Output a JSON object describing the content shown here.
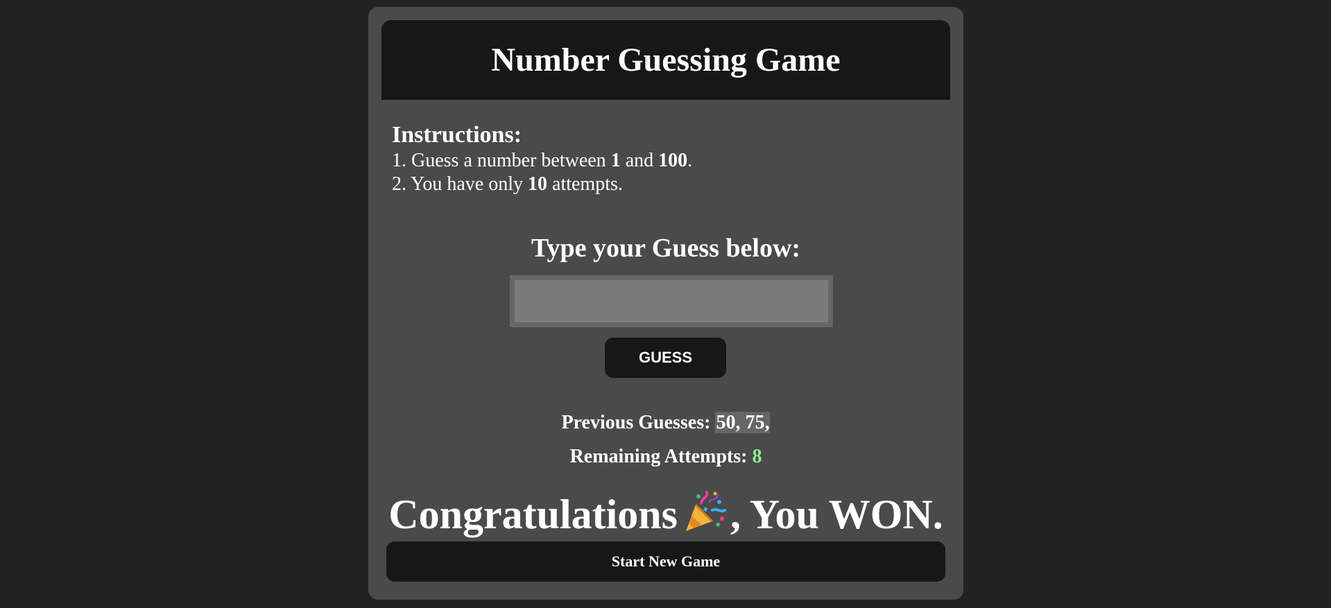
{
  "header": {
    "title": "Number Guessing Game"
  },
  "instructions": {
    "title": "Instructions:",
    "line1_prefix": "1. Guess a number between ",
    "line1_min": "1",
    "line1_mid": " and ",
    "line1_max": "100",
    "line1_suffix": ".",
    "line2_prefix": "2. You have only ",
    "line2_attempts": "10",
    "line2_suffix": " attempts."
  },
  "guess": {
    "prompt": "Type your Guess below:",
    "input_value": "",
    "button_label": "GUESS"
  },
  "status": {
    "previous_label": "Previous Guesses: ",
    "previous_values": "50, 75,",
    "remaining_label": "Remaining Attempts: ",
    "remaining_count": "8",
    "remaining_color": "#90ee90"
  },
  "result": {
    "message_start": "Congratulations",
    "icon": "party-popper-icon",
    "message_end": ", You WON."
  },
  "new_game": {
    "button_label": "Start New Game"
  },
  "colors": {
    "page_background": "#222222",
    "card_background": "#4a4a4a",
    "header_background": "#171717",
    "button_background": "#171717",
    "input_background": "#7a7a7a"
  }
}
